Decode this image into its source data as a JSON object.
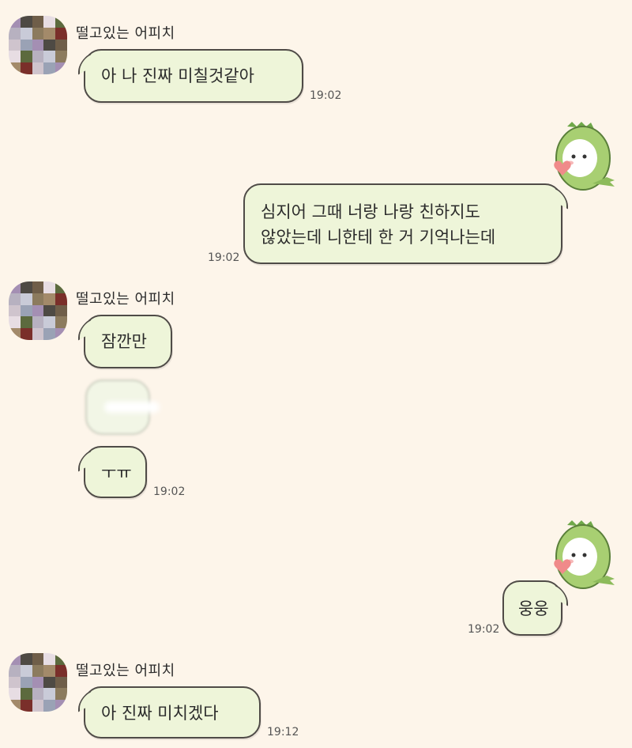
{
  "sender_name": "떨고있는 어피치",
  "messages": [
    {
      "text": "아 나 진짜 미칠것같아",
      "time": "19:02"
    },
    {
      "text": "심지어 그때 너랑 나랑 친하지도\n않았는데 니한테 한 거 기억나는데",
      "time": "19:02"
    },
    {
      "text": "잠깐만"
    },
    {
      "text": "ㅜㅠ",
      "time": "19:02"
    },
    {
      "text": "웅웅",
      "time": "19:02"
    },
    {
      "text": "아 진짜 미치겠다",
      "time": "19:12"
    }
  ],
  "icons": {
    "avatar": "pixelated-avatar",
    "sticker": "dino-costume-character-holding-heart"
  },
  "colors": {
    "background": "#fdf5ea",
    "bubble": "#eef5d9",
    "bubble_border": "#4f4b47"
  }
}
